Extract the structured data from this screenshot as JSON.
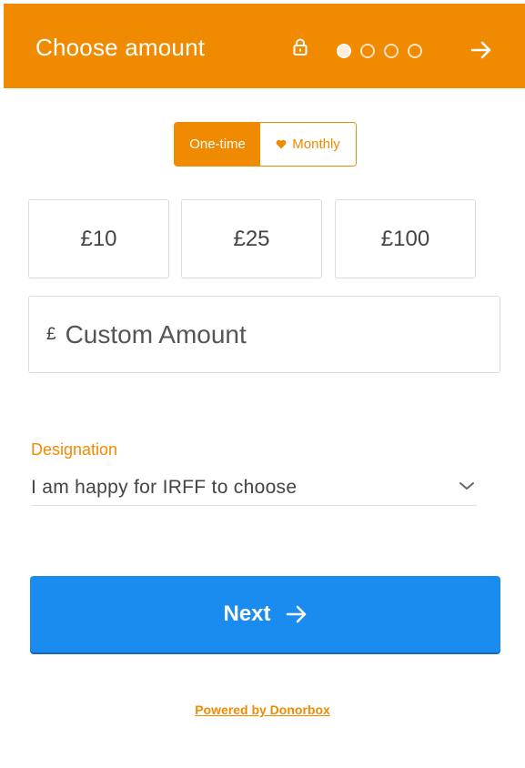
{
  "header": {
    "title": "Choose amount",
    "lock_icon": "lock-icon",
    "steps": [
      true,
      false,
      false,
      false
    ],
    "next_icon": "arrow-right-icon",
    "color": "#f08a00"
  },
  "frequency": {
    "one_time_label": "One-time",
    "monthly_label": "Monthly",
    "monthly_icon": "heart-icon",
    "selected": "One-time"
  },
  "amounts": [
    "£10",
    "£25",
    "£100"
  ],
  "custom_amount": {
    "currency_symbol": "£",
    "placeholder": "Custom Amount",
    "value": ""
  },
  "designation": {
    "label": "Designation",
    "selected_value": "I am happy for IRFF to choose"
  },
  "next_button": {
    "label": "Next",
    "color": "#1a8cf0"
  },
  "footer": {
    "powered_by": "Powered by Donorbox"
  }
}
